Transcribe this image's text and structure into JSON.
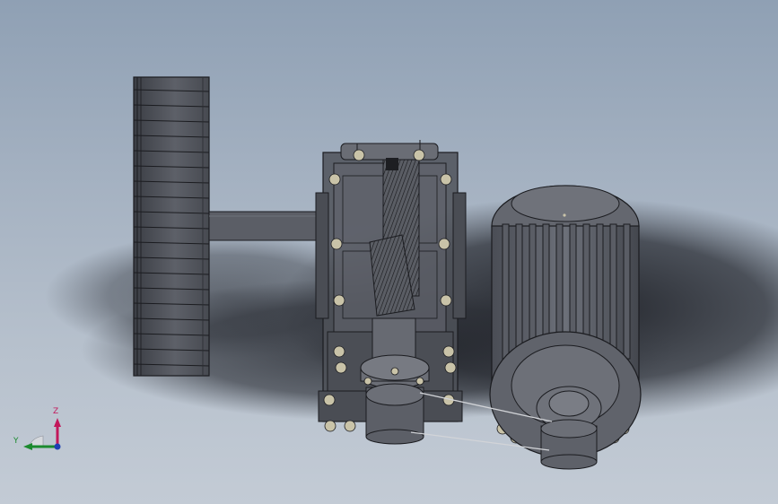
{
  "viewport": {
    "background_top": "#8fa0b4",
    "background_bottom": "#c3cbd5"
  },
  "model": {
    "parts": [
      "fan-wheel",
      "shaft",
      "gearbox-housing",
      "helical-gear",
      "bevel-gear",
      "pulley",
      "drive-belt",
      "electric-motor",
      "motor-pulley"
    ],
    "body_color": "#55585f",
    "edge_color": "#1b1c20",
    "bolt_color": "#c9c3a8"
  },
  "triad": {
    "z_label": "Z",
    "y_label": "Y",
    "z_color": "#c2185b",
    "y_color": "#1b8a2e",
    "x_color": "#1f3fb3"
  }
}
